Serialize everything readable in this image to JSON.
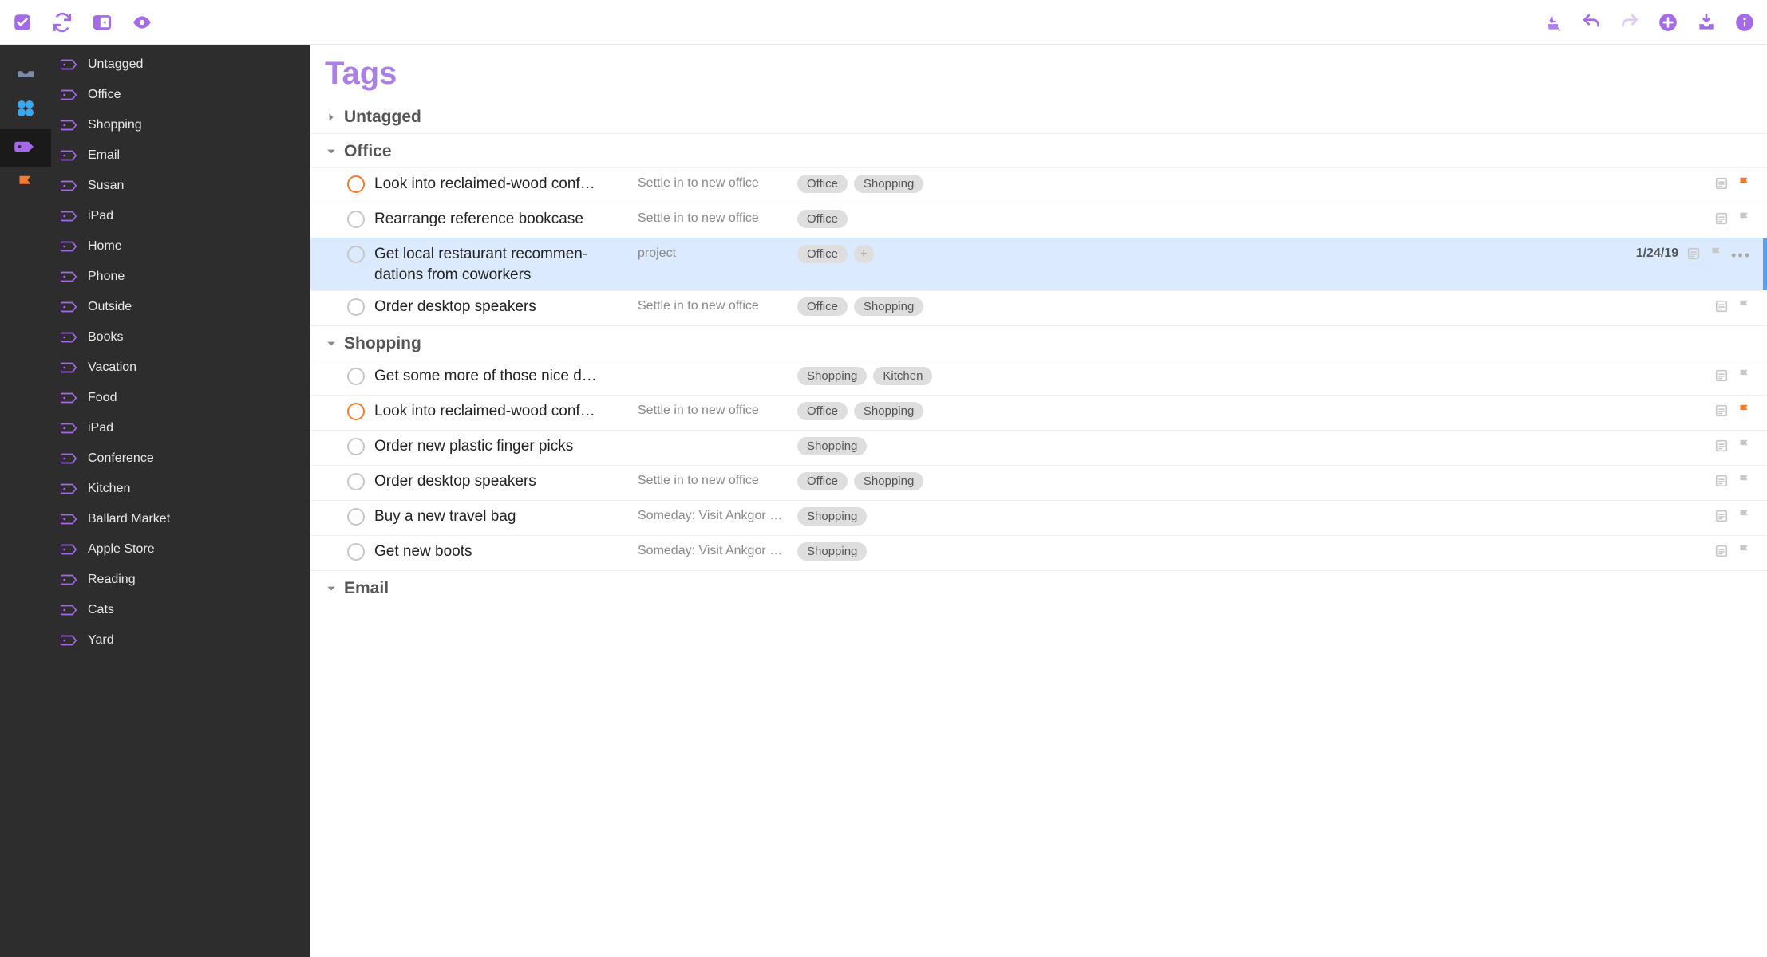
{
  "colors": {
    "accent": "#a46ae8",
    "accent_light": "#aa7fe6",
    "orange": "#f77a2b",
    "blue": "#3aa7f0",
    "gray_icon": "#c7c7c7",
    "selection": "#dbeafe"
  },
  "toolbar": {
    "left": [
      {
        "name": "check-icon"
      },
      {
        "name": "sync-icon"
      },
      {
        "name": "sidebar-toggle-icon"
      },
      {
        "name": "eye-icon"
      }
    ],
    "right": [
      {
        "name": "cleanup-icon"
      },
      {
        "name": "undo-icon"
      },
      {
        "name": "redo-icon"
      },
      {
        "name": "add-icon"
      },
      {
        "name": "inbox-add-icon"
      },
      {
        "name": "info-icon"
      }
    ]
  },
  "rail": [
    {
      "name": "inbox-icon",
      "selected": false,
      "color": "#7e8aa8"
    },
    {
      "name": "projects-icon",
      "selected": false,
      "color": "#3aa7f0"
    },
    {
      "name": "tags-icon",
      "selected": true,
      "color": "#a46ae8"
    },
    {
      "name": "flagged-icon",
      "selected": false,
      "color": "#f77a2b"
    }
  ],
  "sidebar": {
    "items": [
      {
        "label": "Untagged"
      },
      {
        "label": "Office"
      },
      {
        "label": "Shopping"
      },
      {
        "label": "Email"
      },
      {
        "label": "Susan"
      },
      {
        "label": "iPad"
      },
      {
        "label": "Home"
      },
      {
        "label": "Phone"
      },
      {
        "label": "Outside"
      },
      {
        "label": "Books"
      },
      {
        "label": "Vacation"
      },
      {
        "label": "Food"
      },
      {
        "label": "iPad"
      },
      {
        "label": "Conference"
      },
      {
        "label": "Kitchen"
      },
      {
        "label": "Ballard Market"
      },
      {
        "label": "Apple Store"
      },
      {
        "label": "Reading"
      },
      {
        "label": "Cats"
      },
      {
        "label": "Yard"
      }
    ]
  },
  "main": {
    "title": "Tags",
    "sections": [
      {
        "label": "Untagged",
        "open": false,
        "tasks": []
      },
      {
        "label": "Office",
        "open": true,
        "tasks": [
          {
            "title": "Look into reclaimed-wood conf…",
            "project": "Settle in to new office",
            "tags": [
              "Office",
              "Shopping"
            ],
            "flag": true,
            "note": true,
            "circle": "orange"
          },
          {
            "title": "Rearrange reference bookcase",
            "project": "Settle in to new office",
            "tags": [
              "Office"
            ],
            "flag": false,
            "note": true,
            "circle": "gray"
          },
          {
            "title": "Get local restaurant recommen­dations from coworkers",
            "project": "project",
            "tags": [
              "Office"
            ],
            "plus": true,
            "flag": false,
            "note": true,
            "circle": "gray",
            "selected": true,
            "due": "1/24/19",
            "more": true
          },
          {
            "title": "Order desktop speakers",
            "project": "Settle in to new office",
            "tags": [
              "Office",
              "Shopping"
            ],
            "flag": false,
            "note": true,
            "circle": "gray"
          }
        ]
      },
      {
        "label": "Shopping",
        "open": true,
        "tasks": [
          {
            "title": "Get some more of those nice d…",
            "project": "",
            "tags": [
              "Shopping",
              "Kitchen"
            ],
            "flag": false,
            "note": true,
            "circle": "gray"
          },
          {
            "title": "Look into reclaimed-wood conf…",
            "project": "Settle in to new office",
            "tags": [
              "Office",
              "Shopping"
            ],
            "flag": true,
            "note": true,
            "circle": "orange"
          },
          {
            "title": "Order new plastic finger picks",
            "project": "",
            "tags": [
              "Shopping"
            ],
            "flag": false,
            "note": true,
            "circle": "gray"
          },
          {
            "title": "Order desktop speakers",
            "project": "Settle in to new office",
            "tags": [
              "Office",
              "Shopping"
            ],
            "flag": false,
            "note": true,
            "circle": "gray"
          },
          {
            "title": "Buy a new travel bag",
            "project": "Someday: Visit Ankgor …",
            "tags": [
              "Shopping"
            ],
            "flag": false,
            "note": true,
            "circle": "gray"
          },
          {
            "title": "Get new boots",
            "project": "Someday: Visit Ankgor …",
            "tags": [
              "Shopping"
            ],
            "flag": false,
            "note": true,
            "circle": "gray"
          }
        ]
      },
      {
        "label": "Email",
        "open": true,
        "tasks": []
      }
    ]
  }
}
